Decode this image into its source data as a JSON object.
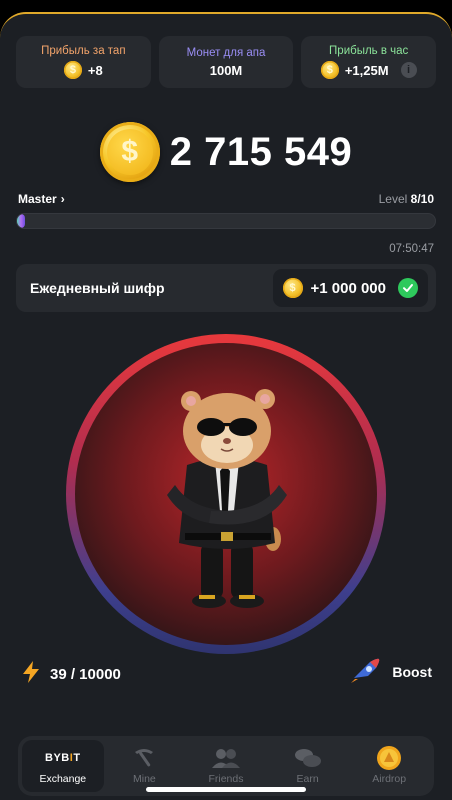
{
  "stats": [
    {
      "label": "Прибыль за тап",
      "value": "+8",
      "icon": "coin-icon",
      "color": "#f3a46b"
    },
    {
      "label": "Монет для апа",
      "value": "100M",
      "color": "#9a8ef5"
    },
    {
      "label": "Прибыль в час",
      "value": "+1,25M",
      "icon": "coin-icon",
      "color": "#8be39a",
      "info": "i"
    }
  ],
  "balance": {
    "value": "2 715 549",
    "coin_symbol": "$"
  },
  "level": {
    "rank": "Master",
    "rank_chevron": "›",
    "prefix": "Level",
    "value": "8/10",
    "progress": 0.02
  },
  "timer": "07:50:47",
  "daily_cipher": {
    "label": "Ежедневный шифр",
    "reward": "+1 000 000",
    "completed": true
  },
  "energy": {
    "value": "39 / 10000",
    "icon": "lightning-icon"
  },
  "boost": {
    "label": "Boost",
    "icon": "rocket-icon"
  },
  "nav": [
    {
      "label": "Exchange",
      "logo": "BYBIT",
      "active": true
    },
    {
      "label": "Mine",
      "icon": "pickaxe-icon"
    },
    {
      "label": "Friends",
      "icon": "friends-icon"
    },
    {
      "label": "Earn",
      "icon": "coins-icon"
    },
    {
      "label": "Airdrop",
      "icon": "airdrop-coin-icon"
    }
  ],
  "colors": {
    "accent": "#f5a623",
    "background": "#1c1f24",
    "card": "#272a2f",
    "success": "#2ec95c"
  }
}
